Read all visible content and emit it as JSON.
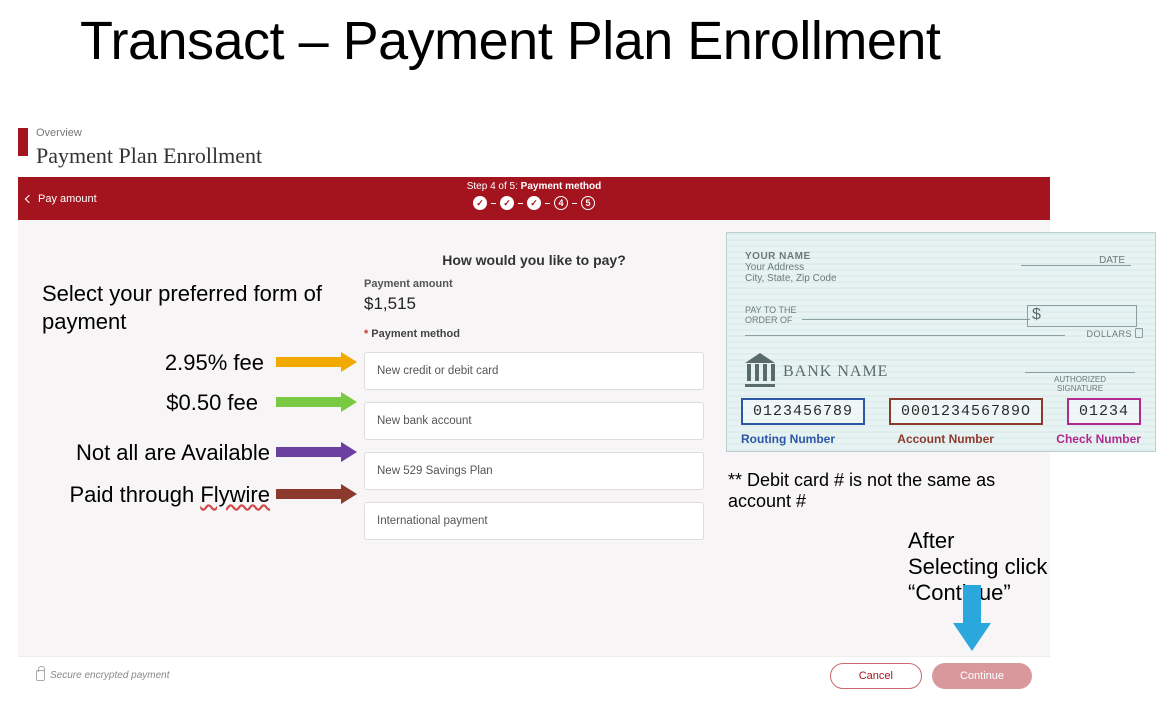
{
  "slide_title": "Transact – Payment Plan Enrollment",
  "breadcrumb": "Overview",
  "page_title": "Payment Plan Enrollment",
  "back_label": "Pay amount",
  "step_text_prefix": "Step 4 of 5: ",
  "step_text_bold": "Payment method",
  "prompt": "How would you like to pay?",
  "amount_label": "Payment amount",
  "amount_value": "$1,515",
  "method_label": "Payment method",
  "options": {
    "credit": "New credit or debit card",
    "bank": "New bank account",
    "plan529": "New 529 Savings Plan",
    "intl": "International payment"
  },
  "annotations": {
    "intro": "Select your preferred form of payment",
    "credit_fee": "2.95% fee",
    "bank_fee": "$0.50 fee",
    "plan529_note": "Not all are Available",
    "intl_note_pre": "Paid through ",
    "intl_note_wavy": "Flywire"
  },
  "check": {
    "name": "YOUR NAME",
    "addr1": "Your Address",
    "addr2": "City, State, Zip Code",
    "date_label": "DATE",
    "pay_to": "PAY TO THE\nORDER OF",
    "dollar_sign": "$",
    "dollars_label": "DOLLARS",
    "bank_name": "BANK NAME",
    "auth_label": "AUTHORIZED\nSIGNATURE",
    "routing": "0123456789",
    "account": "000123456789O",
    "checknum": "01234",
    "routing_label": "Routing Number",
    "account_label": "Account Number",
    "checknum_label": "Check Number",
    "box_colors": {
      "routing": "#2d56a5",
      "account": "#8c3a2d",
      "checknum": "#b02a8f"
    }
  },
  "debit_note": "** Debit card # is not the same as account #",
  "after_note": "After Selecting click “Continue”",
  "footer_secure": "Secure encrypted payment",
  "buttons": {
    "cancel": "Cancel",
    "continue": "Continue"
  }
}
